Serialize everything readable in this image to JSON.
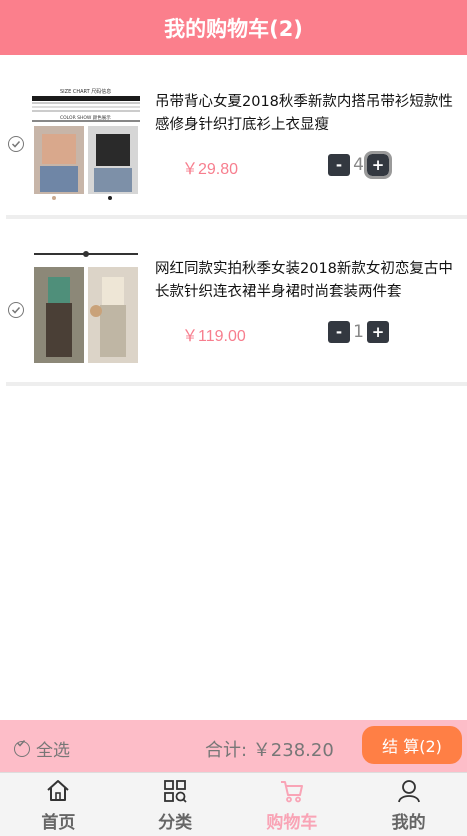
{
  "header": {
    "title": "我的购物车(2)"
  },
  "items": [
    {
      "title": "吊带背心女夏2018秋季新款内搭吊带衫短款性感修身针织打底衫上衣显瘦",
      "price": "￥29.80",
      "quantity": "4",
      "minus": "-",
      "plus": "+",
      "thumb_header": "SIZE CHART  尺码信息",
      "thumb_footer": "COLOR SHOW  颜色展示"
    },
    {
      "title": "网红同款实拍秋季女装2018新款女初恋复古中长款针织连衣裙半身裙时尚套装两件套",
      "price": "￥119.00",
      "quantity": "1",
      "minus": "-",
      "plus": "+"
    }
  ],
  "checkout": {
    "select_all": "全选",
    "total": "合计: ￥238.20",
    "button": "结 算(2)"
  },
  "tabbar": [
    {
      "label": "首页",
      "icon": "home-icon"
    },
    {
      "label": "分类",
      "icon": "category-icon"
    },
    {
      "label": "购物车",
      "icon": "cart-icon",
      "active": true
    },
    {
      "label": "我的",
      "icon": "user-icon"
    }
  ],
  "colors": {
    "header": "#fb7f8c",
    "price": "#f77e8e",
    "checkout_bar": "#fdbdc8",
    "checkout_button": "#ff7f45",
    "active_tab": "#f9a4b6"
  }
}
